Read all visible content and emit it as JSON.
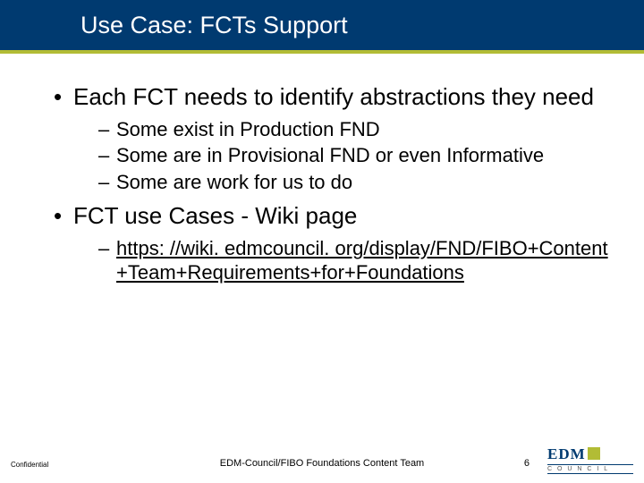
{
  "title": "Use Case: FCTs Support",
  "bullets": [
    {
      "text": "Each FCT needs to identify abstractions they need",
      "sub": [
        "Some exist in Production FND",
        "Some are in Provisional FND or even Informative",
        "Some are work for us to do"
      ]
    },
    {
      "text": "FCT use Cases - Wiki page",
      "sub_link": "https: //wiki. edmcouncil. org/display/FND/FIBO+Content+Team+Requirements+for+Foundations"
    }
  ],
  "footer": {
    "confidential": "Confidential",
    "center": "EDM-Council/FIBO Foundations Content Team",
    "page": "6",
    "logo_main": "EDM",
    "logo_sub": "C O U N C I L"
  }
}
